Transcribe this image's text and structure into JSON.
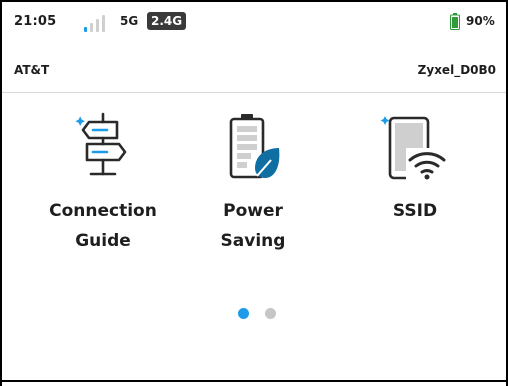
{
  "status": {
    "time": "21:05",
    "network_type": "5G",
    "band": "2.4G",
    "battery_percent": "90%",
    "battery_level": 0.9,
    "signal_bars": 4,
    "signal_active": 1
  },
  "info": {
    "carrier": "AT&T",
    "ssid": "Zyxel_D0B0"
  },
  "tiles": [
    {
      "label_line1": "Connection",
      "label_line2": "Guide",
      "icon": "signpost-icon"
    },
    {
      "label_line1": "Power",
      "label_line2": "Saving",
      "icon": "battery-leaf-icon"
    },
    {
      "label_line1": "SSID",
      "label_line2": "",
      "icon": "tablet-wifi-icon"
    }
  ],
  "pager": {
    "pages": 2,
    "current": 1
  },
  "colors": {
    "accent": "#1e9be8",
    "battery": "#2f9c3c",
    "leaf": "#0f6fa3",
    "dot_inactive": "#c6c6c6",
    "icon_stroke": "#2a2a2a"
  }
}
